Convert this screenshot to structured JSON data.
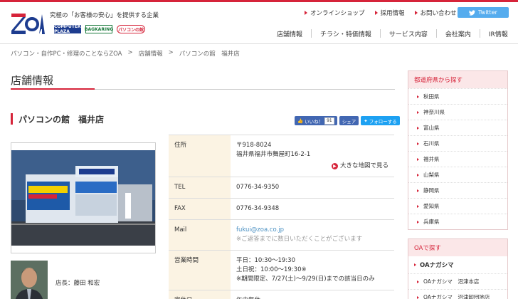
{
  "header": {
    "logo_text": "ZOA",
    "tagline": "究極の「お客様の安心」を提供する企業",
    "brands": [
      "COMPUTER PLAZA",
      "BAGKARING",
      "パソコンの館"
    ],
    "topnav": [
      "オンラインショップ",
      "採用情報",
      "お問い合わせ"
    ],
    "twitter_label": "Twitter",
    "mainnav": [
      "店舗情報",
      "チラシ・特価情報",
      "サービス内容",
      "会社案内",
      "IR情報"
    ]
  },
  "breadcrumb": [
    "パソコン・自作PC・修理のことならZOA",
    ">",
    "店舗情報",
    ">",
    "パソコンの館　福井店"
  ],
  "page_title": "店舗情報",
  "store": {
    "name": "パソコンの館　福井店",
    "social": {
      "like": "いいね！",
      "like_count": "91",
      "share": "シェア",
      "follow": "フォローする"
    },
    "manager": "店長：藤田 和宏"
  },
  "info": {
    "address_label": "住所",
    "postal": "〒918-8024",
    "address": "福井県福井市舞屋町16-2-1",
    "map_link": "大きな地図で見る",
    "tel_label": "TEL",
    "tel": "0776-34-9350",
    "fax_label": "FAX",
    "fax": "0776-34-9348",
    "mail_label": "Mail",
    "mail": "fukui@zoa.co.jp",
    "mail_note": "※ご返答までに数日いただくことがございます",
    "hours_label": "営業時間",
    "hours_1": "平日：10:30～19:30",
    "hours_2": "土日祝：10:00～19:30※",
    "hours_3": "※期間限定、7/27(土)～9/29(日)までの該当日のみ",
    "closed_label": "定休日",
    "closed": "年中無休"
  },
  "sidebar": {
    "pref_head": "都道府県から探す",
    "prefs": [
      "秋田県",
      "神奈川県",
      "富山県",
      "石川県",
      "福井県",
      "山梨県",
      "静岡県",
      "愛知県",
      "兵庫県"
    ],
    "oa_head": "OAで探す",
    "oa_sub": "OAナガシマ",
    "oa_items": [
      "OAナガシマ　沼津本店",
      "OAナガシマ　沼津卸団地店"
    ]
  },
  "colors": {
    "accent": "#d6243a",
    "twitter": "#55acee",
    "facebook": "#4267b2",
    "info_key_bg": "#fbf3e3"
  }
}
